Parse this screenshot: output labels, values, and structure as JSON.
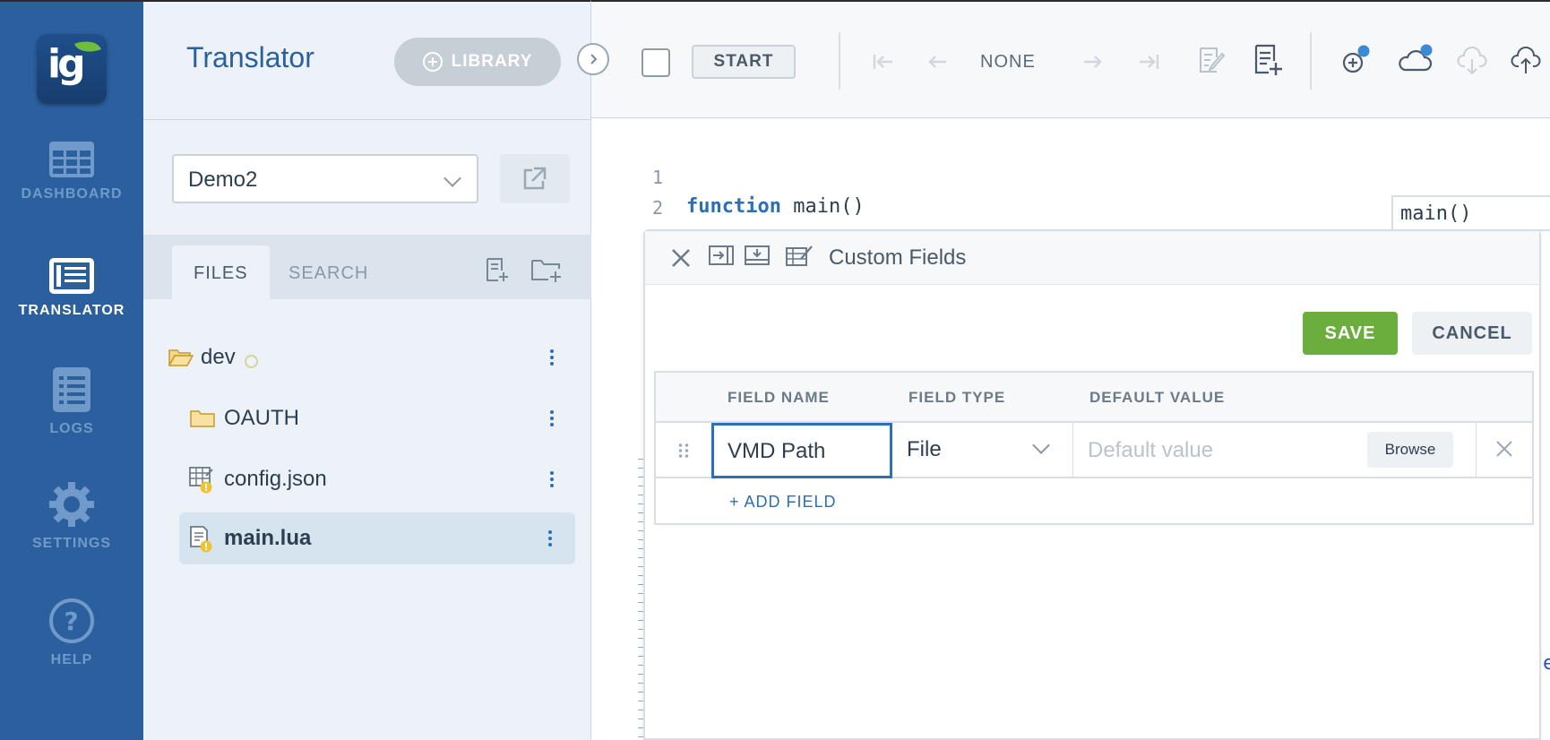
{
  "nav": {
    "logo_text": "ig",
    "items": [
      {
        "label": "DASHBOARD",
        "icon": "dashboard-icon"
      },
      {
        "label": "TRANSLATOR",
        "icon": "translator-icon",
        "active": true
      },
      {
        "label": "LOGS",
        "icon": "logs-icon"
      },
      {
        "label": "SETTINGS",
        "icon": "gear-icon"
      },
      {
        "label": "HELP",
        "icon": "help-icon"
      }
    ]
  },
  "sidebar": {
    "title": "Translator",
    "library_label": "LIBRARY",
    "project": "Demo2",
    "tabs": [
      "FILES",
      "SEARCH"
    ],
    "tree": [
      {
        "name": "dev",
        "icon": "folder-open-icon"
      },
      {
        "name": "OAUTH",
        "icon": "folder-icon"
      },
      {
        "name": "config.json",
        "icon": "json-file-icon"
      },
      {
        "name": "main.lua",
        "icon": "lua-file-icon",
        "selected": true
      }
    ]
  },
  "toolbar": {
    "start_label": "START",
    "nav_label": "NONE"
  },
  "editor": {
    "line_numbers": [
      "1",
      "2"
    ],
    "keyword": "function",
    "code_rest": " main()",
    "function_list": "main()",
    "trailing_char": "e"
  },
  "panel": {
    "title": "Custom Fields",
    "save_label": "SAVE",
    "cancel_label": "CANCEL",
    "columns": [
      "FIELD NAME",
      "FIELD TYPE",
      "DEFAULT VALUE"
    ],
    "row": {
      "field_name": "VMD Path",
      "field_type": "File",
      "default_placeholder": "Default value",
      "browse_label": "Browse"
    },
    "add_field_label": "+ ADD FIELD"
  },
  "colors": {
    "nav_bg": "#2b5f9e",
    "accent": "#2b6fb5",
    "save_green": "#6cae3e",
    "notify_dot": "#3a8ad8"
  }
}
